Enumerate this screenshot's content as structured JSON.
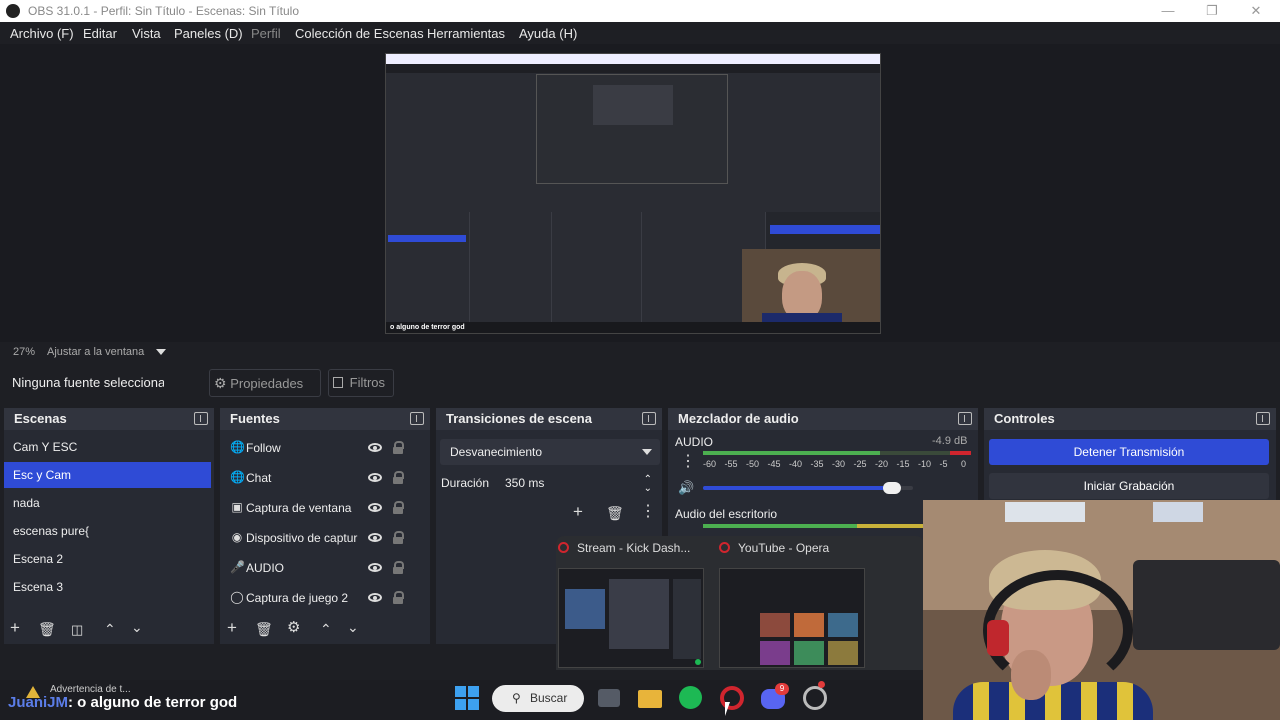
{
  "window": {
    "title": "OBS 31.0.1 - Perfil: Sin Título - Escenas: Sin Título"
  },
  "menu": [
    {
      "label": "Archivo (F)",
      "dim": false
    },
    {
      "label": "Editar",
      "dim": false
    },
    {
      "label": "Vista",
      "dim": false
    },
    {
      "label": "Paneles (D)",
      "dim": false
    },
    {
      "label": "Perfil",
      "dim": true
    },
    {
      "label": "Colección de Escenas",
      "dim": false
    },
    {
      "label": "Herramientas",
      "dim": false
    },
    {
      "label": "Ayuda (H)",
      "dim": false
    }
  ],
  "preview": {
    "zoom": "27%",
    "fit_label": "Ajustar a la ventana",
    "overlay_text": "o alguno de terror god"
  },
  "source_bar": {
    "no_selection": "Ninguna fuente seleccionad",
    "properties": "Propiedades",
    "filters": "Filtros"
  },
  "scenes": {
    "title": "Escenas",
    "items": [
      "Cam Y ESC",
      "Esc y Cam",
      "nada",
      "escenas pure{",
      "Escena 2",
      "Escena 3"
    ],
    "selected_index": 1
  },
  "sources": {
    "title": "Fuentes",
    "items": [
      {
        "label": "Follow",
        "icon": "globe-icon"
      },
      {
        "label": "Chat",
        "icon": "globe-icon"
      },
      {
        "label": "Captura de ventana",
        "icon": "window-icon"
      },
      {
        "label": "Dispositivo de captur",
        "icon": "camera-icon"
      },
      {
        "label": "AUDIO",
        "icon": "microphone-icon"
      },
      {
        "label": "Captura de juego 2",
        "icon": "gamepad-icon"
      }
    ]
  },
  "transitions": {
    "title": "Transiciones de escena",
    "selected": "Desvanecimiento",
    "duration_label": "Duración",
    "duration_value": "350 ms"
  },
  "mixer": {
    "title": "Mezclador de audio",
    "channel_1": "AUDIO",
    "channel_1_db": "-4.9 dB",
    "channel_1_level": 0.66,
    "channel_1_volume": 0.9,
    "channel_2": "Audio del escritorio",
    "scale": [
      "-60",
      "-55",
      "-50",
      "-45",
      "-40",
      "-35",
      "-30",
      "-25",
      "-20",
      "-15",
      "-10",
      "-5",
      "0"
    ]
  },
  "controls": {
    "title": "Controles",
    "stop_stream": "Detener Transmisión",
    "start_record": "Iniciar Grabación"
  },
  "taskbar": {
    "search": "Buscar",
    "warning": "Advertencia de t...",
    "caption_name": "JuaniJM",
    "caption_text": ": o alguno de terror god",
    "thumb_1": "Stream - Kick Dash...",
    "thumb_2": "YouTube - Opera",
    "discord_badge": "9"
  },
  "colors": {
    "accent": "#2f4bd6",
    "meter_green": "#4caf50",
    "meter_yellow": "#c8b23a",
    "meter_red": "#d0252e",
    "opera_red": "#d0252e"
  }
}
